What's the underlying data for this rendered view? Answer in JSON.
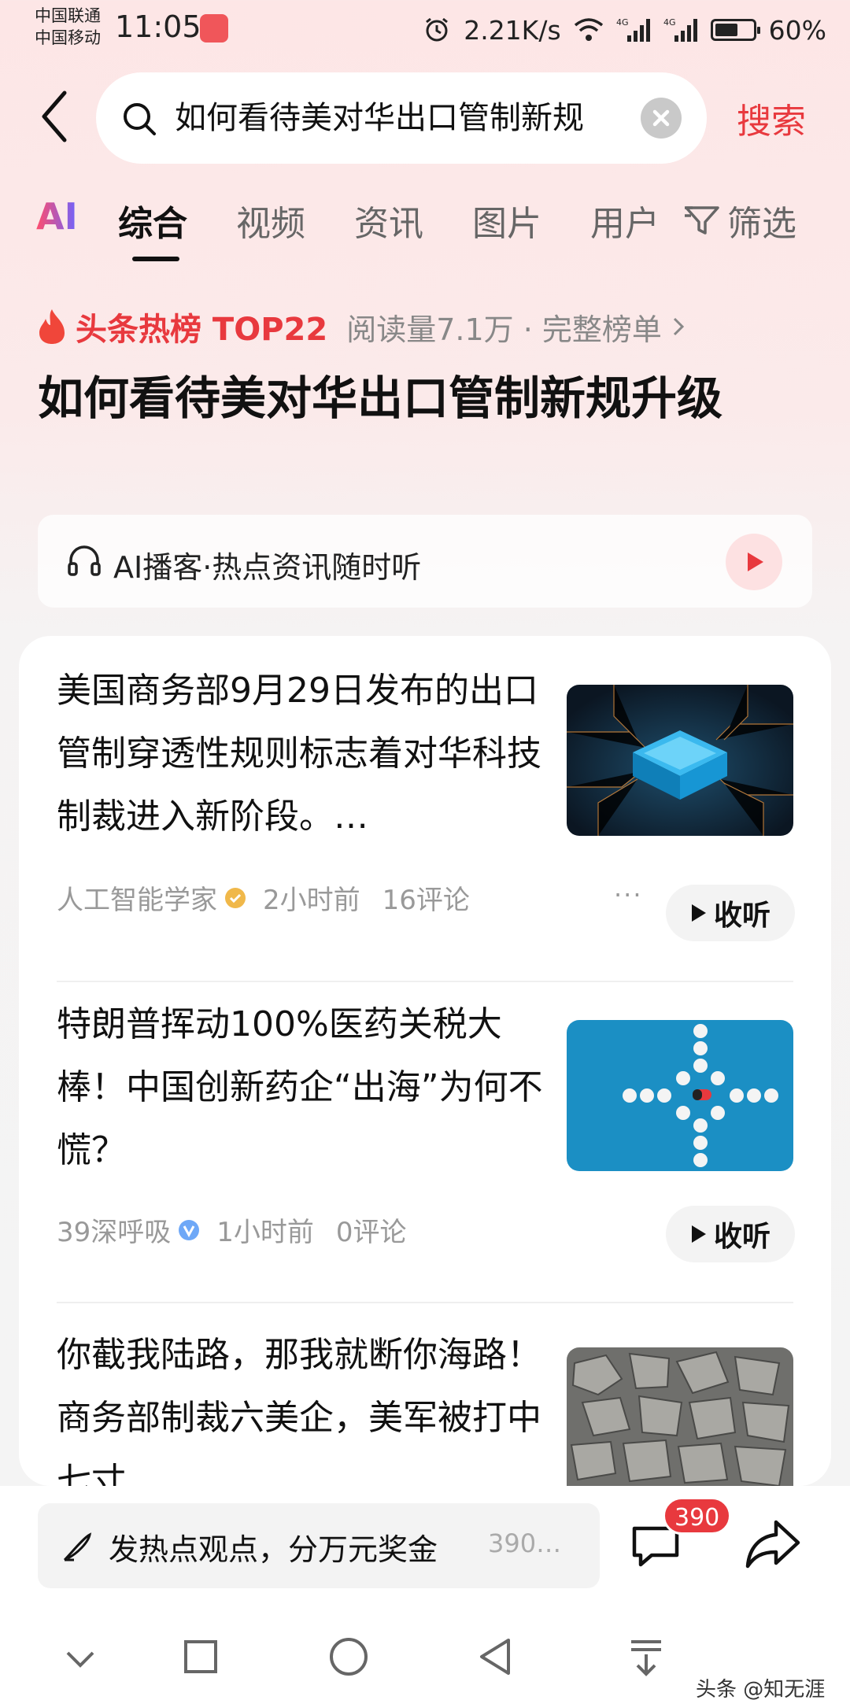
{
  "status_bar": {
    "carrier_1": "中国联通",
    "carrier_2": "中国移动",
    "time": "11:05",
    "network_speed": "2.21K/s",
    "battery": "60%",
    "battery_level": 0.6
  },
  "search": {
    "query": "如何看待美对华出口管制新规",
    "button_label": "搜索"
  },
  "tabs": [
    {
      "label": "AI"
    },
    {
      "label": "综合",
      "active": true
    },
    {
      "label": "视频"
    },
    {
      "label": "资讯"
    },
    {
      "label": "图片"
    },
    {
      "label": "用户"
    }
  ],
  "filter_label": "筛选",
  "hot_list": {
    "title": "头条热榜 TOP22",
    "meta": "阅读量7.1万 · 完整榜单"
  },
  "topic_title": "如何看待美对华出口管制新规升级",
  "podcast": {
    "label": "AI播客·热点资讯随时听"
  },
  "articles": [
    {
      "title": "美国商务部9月29日发布的出口管制穿透性规则标志着对华科技制裁进入新阶段。…",
      "author": "人工智能学家",
      "time": "2小时前",
      "comments": "16评论",
      "listen_label": "收听",
      "more": "···"
    },
    {
      "title": "特朗普挥动100%医药关税大棒！中国创新药企“出海”为何不慌？",
      "author": "39深呼吸",
      "time": "1小时前",
      "comments": "0评论",
      "listen_label": "收听"
    },
    {
      "title": "你截我陆路，那我就断你海路！商务部制裁六美企，美军被打中七寸"
    }
  ],
  "bottom": {
    "comment_placeholder": "发热点观点，分万元奖金",
    "comment_count_hint": "390…",
    "badge_count": "390"
  },
  "watermark": "头条 @知无涯"
}
